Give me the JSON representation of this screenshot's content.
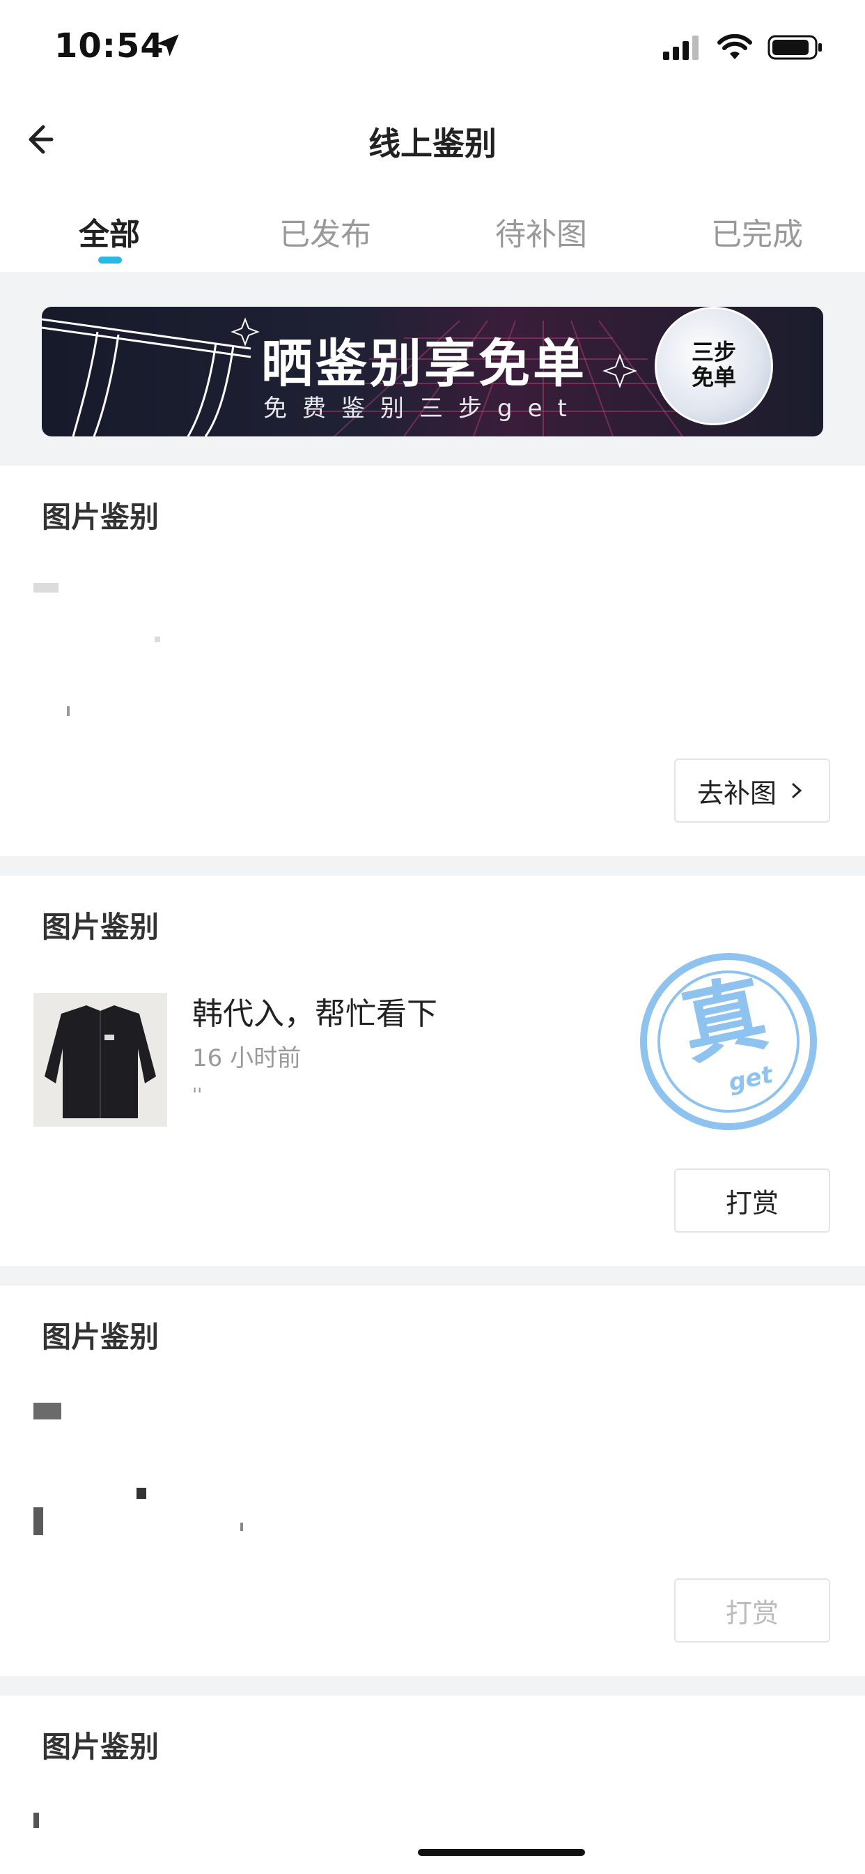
{
  "status_bar": {
    "time": "10:54"
  },
  "header": {
    "title": "线上鉴别"
  },
  "tabs": [
    {
      "label": "全部"
    },
    {
      "label": "已发布"
    },
    {
      "label": "待补图"
    },
    {
      "label": "已完成"
    }
  ],
  "banner": {
    "title": "晒鉴别享免单",
    "subtitle": "免费鉴别三步get",
    "badge_line1": "三步",
    "badge_line2": "免单"
  },
  "cards": [
    {
      "title": "图片鉴别",
      "button_label": "去补图"
    },
    {
      "title": "图片鉴别",
      "item_title": "韩代入，帮忙看下",
      "item_time": "16 小时前",
      "item_meta": "''",
      "stamp_main": "真",
      "stamp_sub": "get",
      "button_label": "打赏"
    },
    {
      "title": "图片鉴别",
      "button_label": "打赏"
    },
    {
      "title": "图片鉴别"
    }
  ],
  "colors": {
    "accent": "#2bb8e6",
    "stamp": "#8fc3ef",
    "background": "#f2f3f5"
  }
}
